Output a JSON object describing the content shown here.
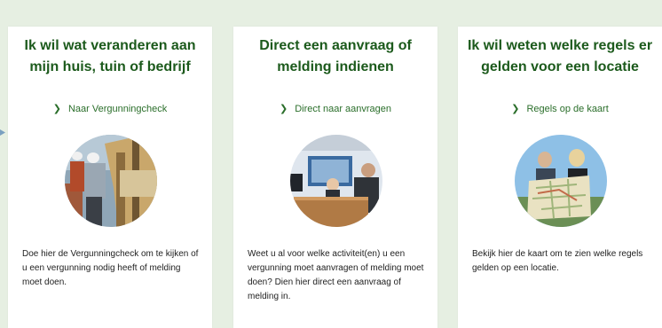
{
  "cards": [
    {
      "title_line1": "Ik wil wat veranderen aan",
      "title_line2": "mijn huis, tuin of bedrijf",
      "link_label": "Naar Vergunningcheck",
      "link_icon": "chevron-right-icon",
      "image": "construction-workers-photo",
      "description": "Doe hier de Vergunningcheck om te kijken of u een vergunning nodig heeft of melding moet doen."
    },
    {
      "title_line1": "Direct een aanvraag of",
      "title_line2": "melding indienen",
      "link_label": "Direct naar aanvragen",
      "link_icon": "chevron-right-icon",
      "image": "service-desk-photo",
      "description": "Weet u al voor welke activiteit(en) u een vergunning moet aanvragen of melding moet doen? Dien hier direct een aanvraag of melding in."
    },
    {
      "title_line1": "Ik wil weten welke regels er",
      "title_line2": "gelden voor een locatie",
      "link_label": "Regels op de kaart",
      "link_icon": "chevron-right-icon",
      "image": "people-with-map-photo",
      "description": "Bekijk hier de kaart om te zien welke regels gelden op een locatie."
    }
  ],
  "colors": {
    "background": "#e6efe2",
    "title": "#1c5a1c",
    "link": "#2a6e2a"
  }
}
